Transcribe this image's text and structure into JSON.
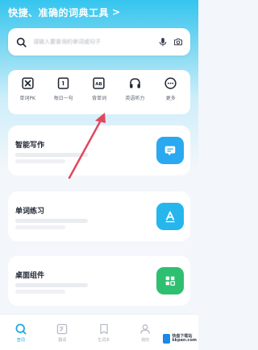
{
  "header": {
    "slogan": "快捷、准确的词典工具",
    "slogan_chevron": ">"
  },
  "search": {
    "placeholder": "请输入要查询的单词或句子",
    "icons": [
      "search-icon",
      "microphone-icon",
      "camera-icon"
    ]
  },
  "tools": [
    {
      "label": "单词PK",
      "icon": "vs-icon"
    },
    {
      "label": "每日一句",
      "icon": "daily-sentence-icon"
    },
    {
      "label": "背单词",
      "icon": "ab-card-icon"
    },
    {
      "label": "英语听力",
      "icon": "headphones-icon"
    },
    {
      "label": "更多",
      "icon": "more-icon"
    }
  ],
  "cards": [
    {
      "title": "智能写作",
      "icon": "chat-bubble-icon",
      "color": "#2aa8f0"
    },
    {
      "title": "单词练习",
      "icon": "letter-a-icon",
      "color": "#26b6ec"
    },
    {
      "title": "桌面组件",
      "icon": "widget-grid-icon",
      "color": "#2fbf71"
    }
  ],
  "tabbar": [
    {
      "label": "查词",
      "icon": "search-tab-icon",
      "active": true
    },
    {
      "label": "翻译",
      "icon": "translate-tab-icon",
      "active": false
    },
    {
      "label": "生词本",
      "icon": "notebook-tab-icon",
      "active": false
    },
    {
      "label": "我的",
      "icon": "profile-tab-icon",
      "active": false
    }
  ],
  "watermark": {
    "line1": "快盘下载站",
    "line2": "kkpan.com"
  },
  "colors": {
    "accent": "#1ba7e0",
    "header_top": "#35c5ef",
    "annotation_arrow": "#e0485f"
  }
}
